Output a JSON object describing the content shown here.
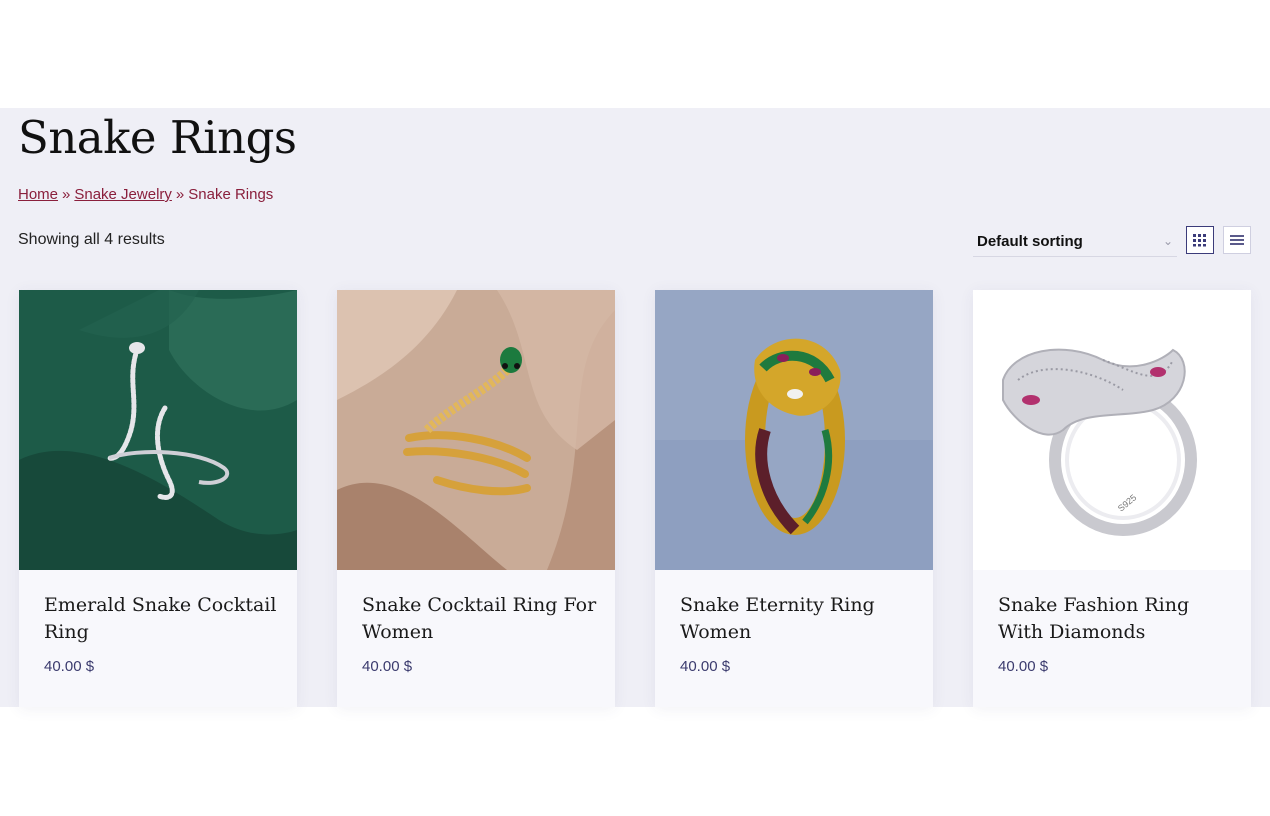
{
  "page": {
    "title": "Snake Rings",
    "breadcrumb": {
      "home": "Home",
      "category": "Snake Jewelry",
      "current": "Snake Rings",
      "separator": "»"
    },
    "result_count": "Showing all 4 results",
    "sorting": {
      "selected": "Default sorting"
    },
    "view_modes": [
      "grid-view-icon",
      "list-view-icon"
    ],
    "accent_color": "#8a1f3c",
    "price_color": "#3b3b6e"
  },
  "products": [
    {
      "name": "Emerald Snake Cocktail Ring",
      "price": "40.00 $"
    },
    {
      "name": "Snake Cocktail Ring For Women",
      "price": "40.00 $"
    },
    {
      "name": "Snake Eternity Ring Women",
      "price": "40.00 $"
    },
    {
      "name": "Snake Fashion Ring With Diamonds",
      "price": "40.00 $"
    }
  ]
}
